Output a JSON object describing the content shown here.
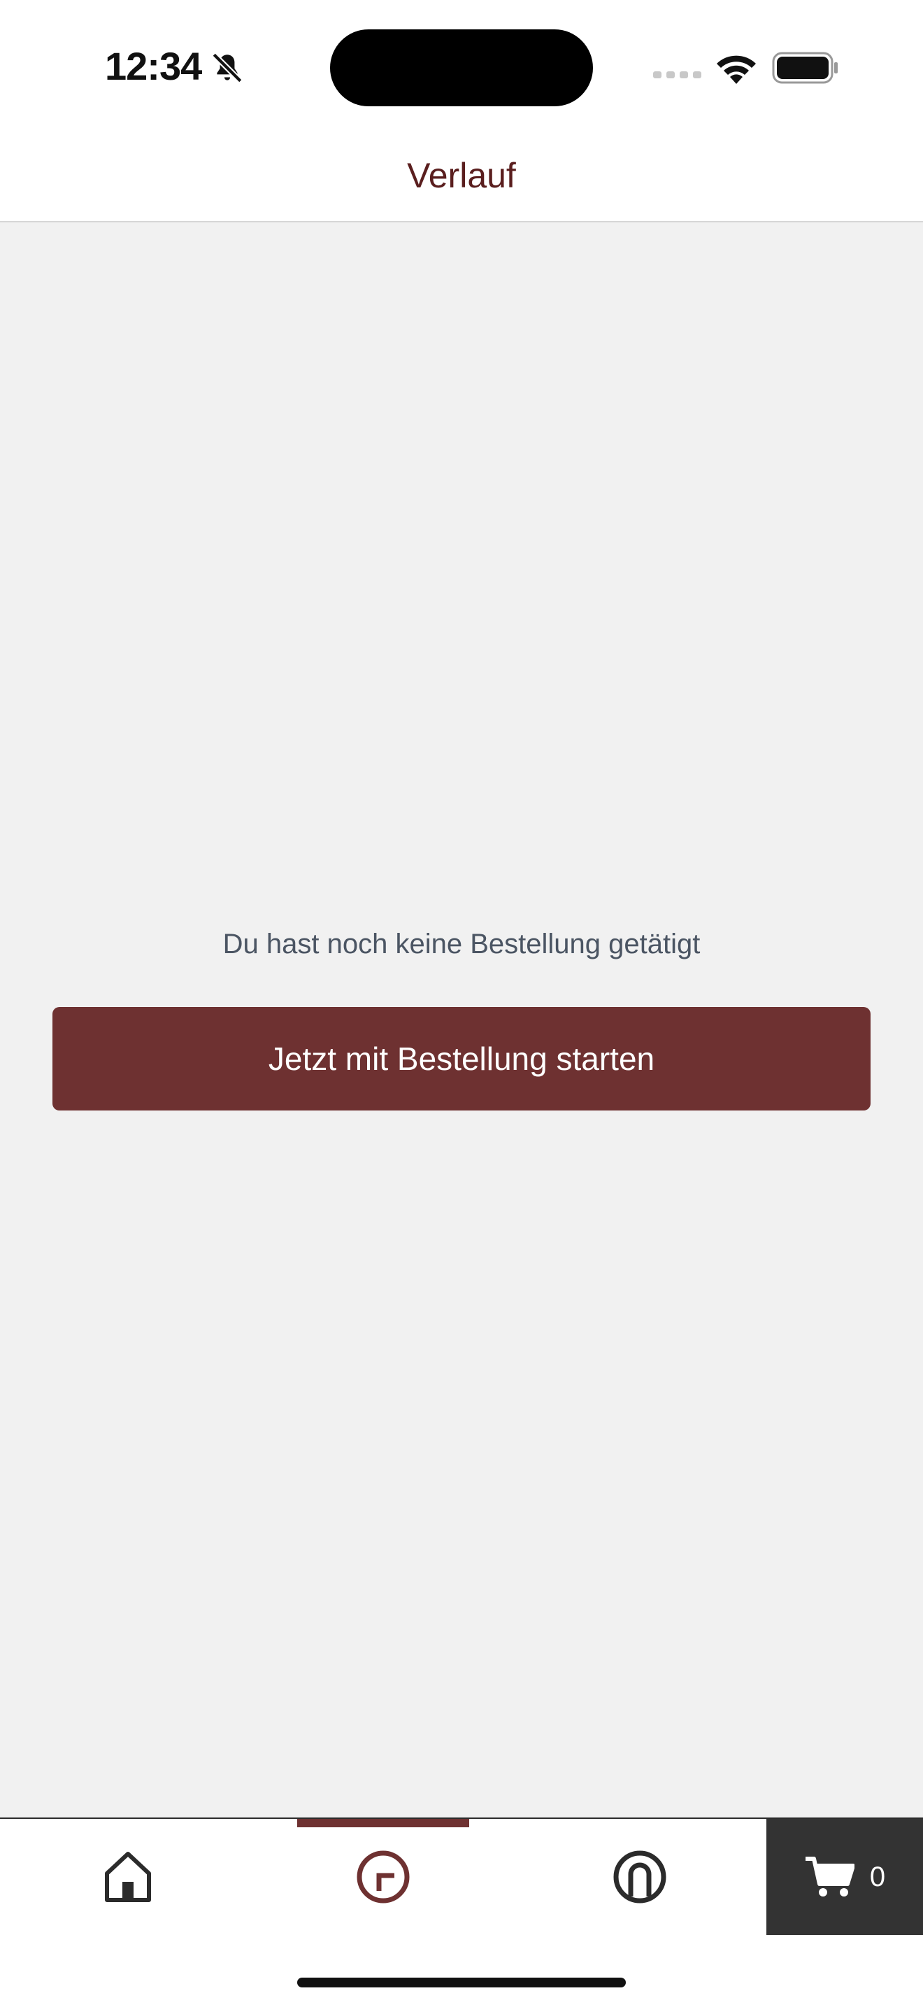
{
  "status_bar": {
    "time": "12:34",
    "icons": [
      "bell-slash-icon",
      "signal-icon",
      "wifi-icon",
      "battery-icon"
    ]
  },
  "header": {
    "title": "Verlauf"
  },
  "main": {
    "empty_message": "Du hast noch keine Bestellung getätigt",
    "start_button_label": "Jetzt mit Bestellung starten"
  },
  "tab_bar": {
    "items": [
      {
        "icon": "home-icon",
        "active": false
      },
      {
        "icon": "history-icon",
        "active": true
      },
      {
        "icon": "profile-icon",
        "active": false
      }
    ],
    "cart": {
      "icon": "cart-icon",
      "count": "0"
    }
  },
  "colors": {
    "accent": "#6e3131",
    "title": "#5a1e1e",
    "background": "#f1f1f1",
    "cart_background": "#333333",
    "message_text": "#4b5563"
  }
}
